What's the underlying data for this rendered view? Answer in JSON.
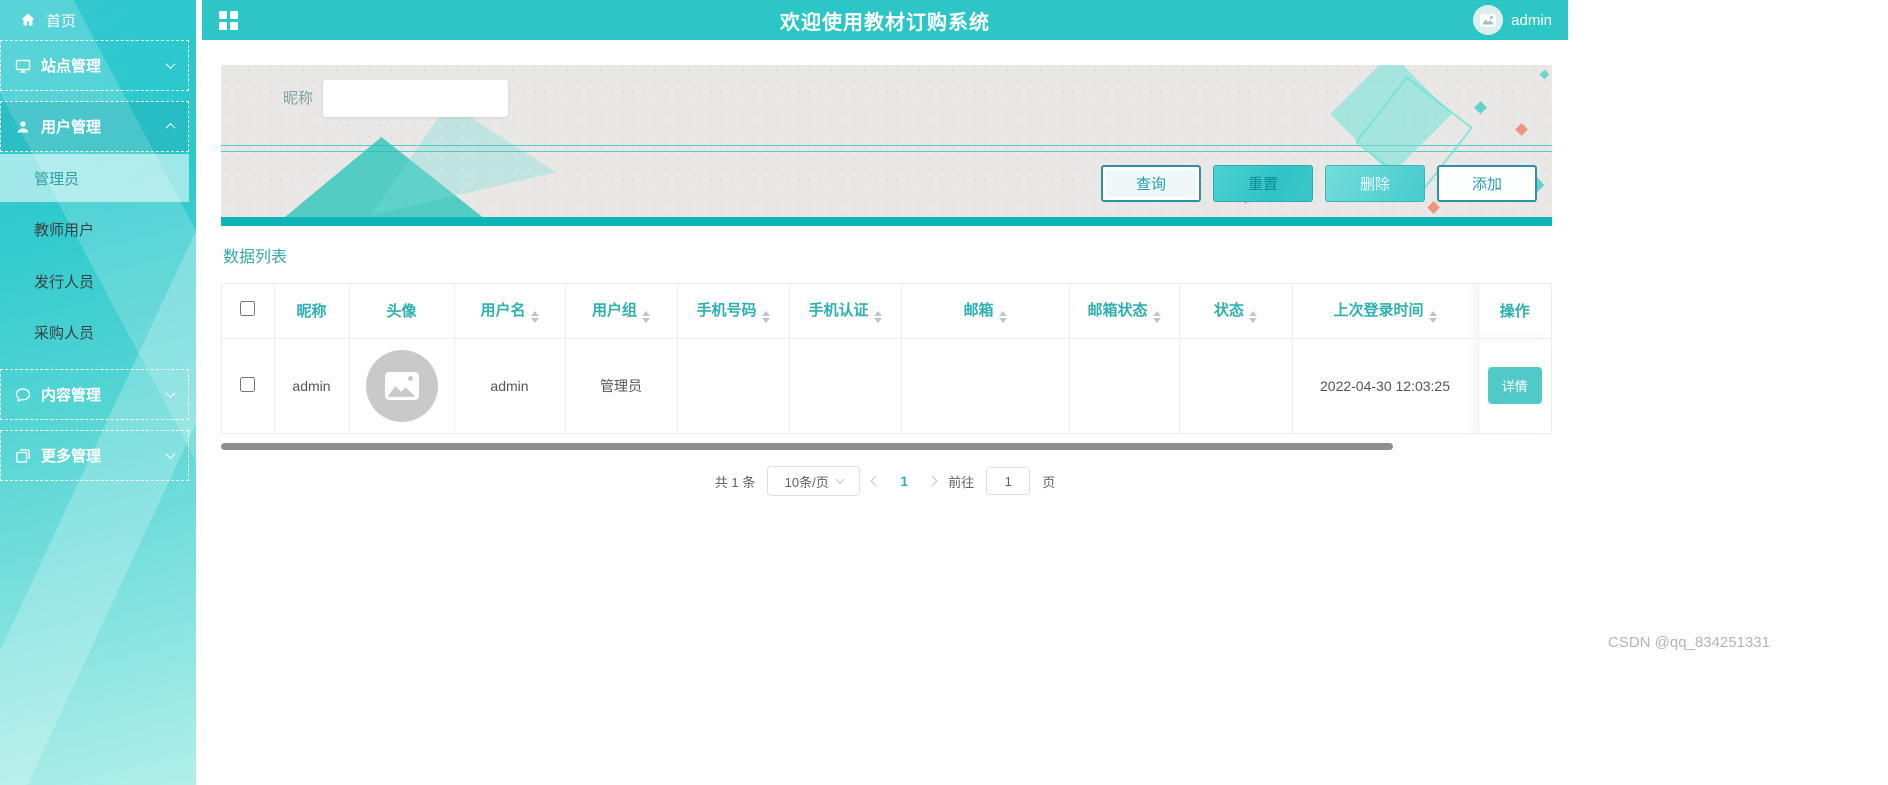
{
  "app": {
    "accent_color": "#2cc6c6"
  },
  "topbar": {
    "title": "欢迎使用教材订购系统",
    "username": "admin"
  },
  "sidebar": {
    "home": "首页",
    "groups": [
      {
        "label": "站点管理"
      },
      {
        "label": "用户管理"
      },
      {
        "label": "内容管理"
      },
      {
        "label": "更多管理"
      }
    ],
    "submenu": [
      {
        "label": "管理员"
      },
      {
        "label": "教师用户"
      },
      {
        "label": "发行人员"
      },
      {
        "label": "采购人员"
      }
    ]
  },
  "filter": {
    "nickname_label": "昵称",
    "nickname_value": "",
    "buttons": {
      "query": "查询",
      "reset": "重置",
      "delete": "删除",
      "add": "添加"
    }
  },
  "list": {
    "title": "数据列表"
  },
  "table": {
    "columns": [
      {
        "label": "昵称"
      },
      {
        "label": "头像"
      },
      {
        "label": "用户名"
      },
      {
        "label": "用户组"
      },
      {
        "label": "手机号码"
      },
      {
        "label": "手机认证"
      },
      {
        "label": "邮箱"
      },
      {
        "label": "邮箱状态"
      },
      {
        "label": "状态"
      },
      {
        "label": "上次登录时间"
      },
      {
        "label": "操作"
      }
    ],
    "row": {
      "nickname": "admin",
      "username": "admin",
      "group": "管理员",
      "phone": "",
      "phone_verified": "",
      "email": "",
      "email_status": "",
      "status": "",
      "last_login": "2022-04-30 12:03:25",
      "detail_button": "详情"
    }
  },
  "pagination": {
    "total": "共 1 条",
    "page_size": "10条/页",
    "current_page": "1",
    "goto_label": "前往",
    "goto_value": "1",
    "page_unit": "页"
  },
  "watermark": "CSDN @qq_834251331"
}
